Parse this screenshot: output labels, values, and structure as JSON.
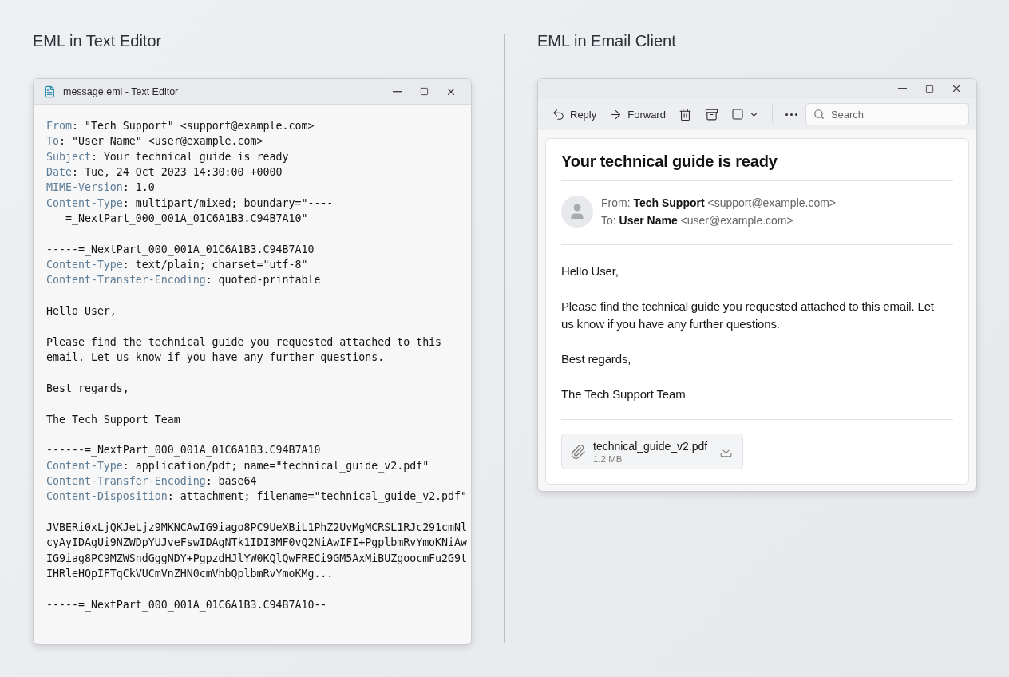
{
  "text_editor_panel": {
    "heading": "EML in Text Editor",
    "window": {
      "title": "message.eml - Text Editor",
      "lines": [
        {
          "kind": "header",
          "key": "From",
          "value": ": \"Tech Support\" <support@example.com>"
        },
        {
          "kind": "header",
          "key": "To",
          "value": ": \"User Name\" <user@example.com>"
        },
        {
          "kind": "header",
          "key": "Subject",
          "value": ": Your technical guide is ready"
        },
        {
          "kind": "header",
          "key": "Date",
          "value": ": Tue, 24 Oct 2023 14:30:00 +0000"
        },
        {
          "kind": "header",
          "key": "MIME-Version",
          "value": ": 1.0"
        },
        {
          "kind": "header",
          "key": "Content-Type",
          "value": ": multipart/mixed; boundary=\"----"
        },
        {
          "kind": "continuation",
          "text": "=_NextPart_000_001A_01C6A1B3.C94B7A10\""
        },
        {
          "kind": "blank"
        },
        {
          "kind": "plain",
          "text": "-----=_NextPart_000_001A_01C6A1B3.C94B7A10"
        },
        {
          "kind": "header",
          "key": "Content-Type",
          "value": ": text/plain; charset=\"utf-8\""
        },
        {
          "kind": "header",
          "key": "Content-Transfer-Encoding",
          "value": ": quoted-printable"
        },
        {
          "kind": "blank"
        },
        {
          "kind": "plain",
          "text": "Hello User,"
        },
        {
          "kind": "blank"
        },
        {
          "kind": "plain",
          "text": "Please find the technical guide you requested attached to this"
        },
        {
          "kind": "plain",
          "text": "email. Let us know if you have any further questions."
        },
        {
          "kind": "blank"
        },
        {
          "kind": "plain",
          "text": "Best regards,"
        },
        {
          "kind": "blank"
        },
        {
          "kind": "plain",
          "text": "The Tech Support Team"
        },
        {
          "kind": "blank"
        },
        {
          "kind": "plain",
          "text": "------=_NextPart_000_001A_01C6A1B3.C94B7A10"
        },
        {
          "kind": "header",
          "key": "Content-Type",
          "value": ": application/pdf; name=\"technical_guide_v2.pdf\""
        },
        {
          "kind": "header",
          "key": "Content-Transfer-Encoding",
          "value": ": base64"
        },
        {
          "kind": "header",
          "key": "Content-Disposition",
          "value": ": attachment; filename=\"technical_guide_v2.pdf\""
        },
        {
          "kind": "blank"
        },
        {
          "kind": "plain",
          "text": "JVBERi0xLjQKJeLjz9MKNCAwIG9iago8PC9UeXBiL1PhZ2UvMgMCRSL1RJc291cmNl"
        },
        {
          "kind": "plain",
          "text": "cyAyIDAgUi9NZWDpYUJveFswIDAgNTk1IDI3MF0vQ2NiAwIFI+PgplbmRvYmoKNiAw"
        },
        {
          "kind": "plain",
          "text": "IG9iag8PC9MZWSndGggNDY+PgpzdHJlYW0KQlQwFRECi9GM5AxMiBUZgoocmFu2G9t"
        },
        {
          "kind": "plain",
          "text": "IHRleHQpIFTqCkVUCmVnZHN0cmVhbQplbmRvYmoKMg..."
        },
        {
          "kind": "blank"
        },
        {
          "kind": "plain",
          "text": "-----=_NextPart_000_001A_01C6A1B3.C94B7A10--"
        }
      ]
    }
  },
  "email_client_panel": {
    "heading": "EML in Email Client",
    "window": {
      "toolbar": {
        "actions": [
          {
            "kind": "reply",
            "label": "Reply"
          },
          {
            "kind": "forward",
            "label": "Forward"
          }
        ]
      },
      "search": {
        "placeholder": "Search"
      },
      "message": {
        "subject": "Your technical guide is ready",
        "from": "From: **Tech Support** <support@example.com>",
        "to": "To: **User Name** <user@example.com>",
        "body": [
          "Hello User,",
          "Please find the technical guide you requested attached to this email. Let us know if you have any further questions.",
          "Best regards,",
          "The Tech Support Team"
        ],
        "attachment": {
          "filename": "technical_guide_v2.pdf",
          "size": "1.2 MB"
        }
      }
    }
  }
}
